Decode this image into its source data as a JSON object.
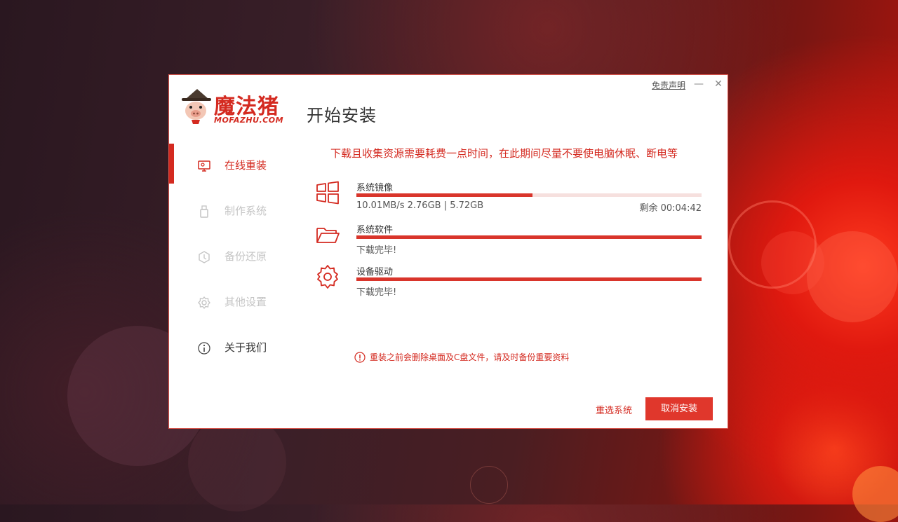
{
  "app": {
    "brand_cn": "魔法猪",
    "brand_en": "MOFAZHU.COM",
    "page_title": "开始安装",
    "disclaimer": "免责声明",
    "minimize": "—",
    "close": "✕"
  },
  "sidebar": {
    "items": [
      {
        "label": "在线重装",
        "icon": "monitor-icon",
        "state": "active"
      },
      {
        "label": "制作系统",
        "icon": "usb-icon",
        "state": "disabled"
      },
      {
        "label": "备份还原",
        "icon": "backup-icon",
        "state": "disabled"
      },
      {
        "label": "其他设置",
        "icon": "gear-icon",
        "state": "disabled"
      },
      {
        "label": "关于我们",
        "icon": "info-icon",
        "state": "normal"
      }
    ]
  },
  "main": {
    "notice": "下载且收集资源需要耗费一点时间，在此期间尽量不要使电脑休眠、断电等",
    "tasks": [
      {
        "name": "系统镜像",
        "icon": "windows-icon",
        "progress": 0.51,
        "status": "10.01MB/s 2.76GB | 5.72GB",
        "remaining": "剩余 00:04:42"
      },
      {
        "name": "系统软件",
        "icon": "folder-icon",
        "progress": 1.0,
        "status": "下载完毕!"
      },
      {
        "name": "设备驱动",
        "icon": "gear-icon",
        "progress": 1.0,
        "status": "下载完毕!"
      }
    ],
    "warning": "重装之前会删除桌面及C盘文件，请及时备份重要资料"
  },
  "footer": {
    "reselect_label": "重选系统",
    "cancel_label": "取消安装"
  },
  "colors": {
    "accent": "#d42a20",
    "button": "#e0372c",
    "progress_track": "#f6e0de"
  }
}
